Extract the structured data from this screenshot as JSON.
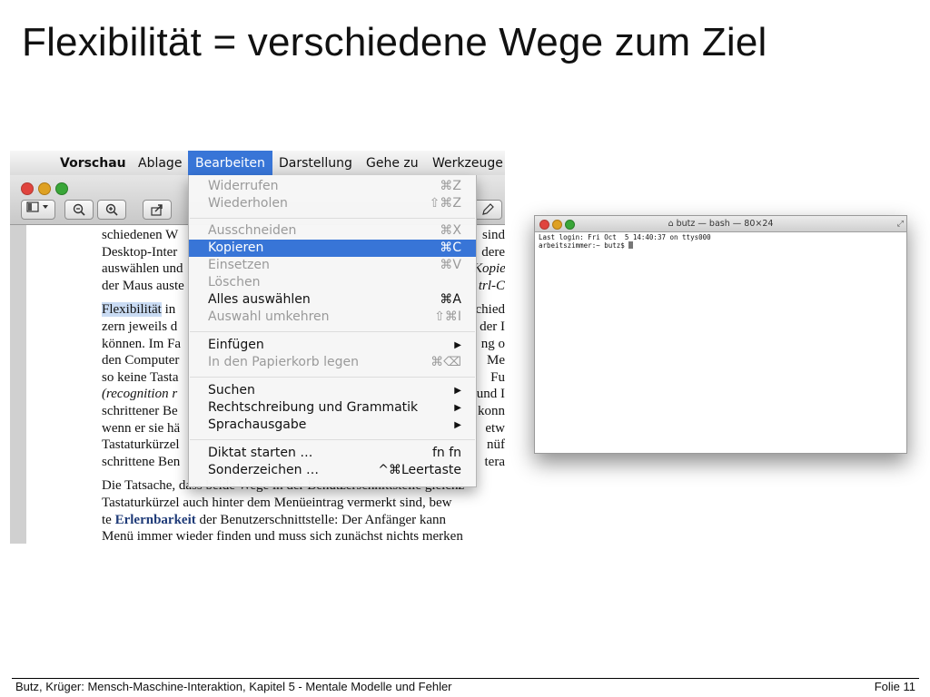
{
  "slide": {
    "title": "Flexibilität = verschiedene Wege zum Ziel",
    "footer_left": "Butz, Krüger: Mensch-Maschine-Interaktion, Kapitel 5 - Mentale Modelle und Fehler",
    "footer_right": "Folie  11"
  },
  "preview": {
    "menubar": {
      "apple": "",
      "items": [
        "Vorschau",
        "Ablage",
        "Bearbeiten",
        "Darstellung",
        "Gehe zu",
        "Werkzeuge"
      ],
      "active_index": 2
    },
    "menu": {
      "items": [
        {
          "label": "Widerrufen",
          "shortcut": "⌘Z",
          "state": "disabled"
        },
        {
          "label": "Wiederholen",
          "shortcut": "⇧⌘Z",
          "state": "disabled"
        },
        {
          "label": "Ausschneiden",
          "shortcut": "⌘X",
          "state": "disabled"
        },
        {
          "label": "Kopieren",
          "shortcut": "⌘C",
          "state": "selected"
        },
        {
          "label": "Einsetzen",
          "shortcut": "⌘V",
          "state": "disabled"
        },
        {
          "label": "Löschen",
          "shortcut": "",
          "state": "disabled"
        },
        {
          "label": "Alles auswählen",
          "shortcut": "⌘A",
          "state": "enabled"
        },
        {
          "label": "Auswahl umkehren",
          "shortcut": "⇧⌘I",
          "state": "disabled"
        },
        {
          "label": "Einfügen",
          "shortcut": "▶",
          "state": "enabled"
        },
        {
          "label": "In den Papierkorb legen",
          "shortcut": "⌘⌫",
          "state": "disabled"
        },
        {
          "label": "Suchen",
          "shortcut": "▶",
          "state": "enabled"
        },
        {
          "label": "Rechtschreibung und Grammatik",
          "shortcut": "▶",
          "state": "enabled"
        },
        {
          "label": "Sprachausgabe",
          "shortcut": "▶",
          "state": "enabled"
        },
        {
          "label": "Diktat starten …",
          "shortcut": "fn fn",
          "state": "enabled"
        },
        {
          "label": "Sonderzeichen …",
          "shortcut": "^⌘Leertaste",
          "state": "enabled"
        }
      ]
    },
    "doc_lines": [
      "schiedenen W",
      "Desktop-Inter",
      "auswählen und",
      "der Maus auste",
      "",
      "Flexibilität in",
      "zern jeweils d",
      "können. Im Fa",
      "den Computer",
      "so keine Tasta",
      "(recognition r",
      "schrittener Be",
      "wenn er sie hä",
      "Tastaturkürzel",
      "schrittene Ben",
      "",
      "Die Tatsache, dass beide Wege in der Benutzerschnittstelle gleichz",
      "Tastaturkürzel auch hinter dem Menüeintrag vermerkt sind, bew",
      "te Erlernbarkeit der Benutzerschnittstelle: Der Anfänger kann",
      "Menü immer wieder finden und muss sich zunächst nichts merken"
    ],
    "doc_right_fragments": [
      "sind",
      "dere",
      "Kopie",
      "trl-C",
      "",
      "chied",
      "der I",
      "ng o",
      "Me",
      "Fu",
      "und I",
      "konn",
      "etw",
      "nüf",
      "tera"
    ]
  },
  "terminal": {
    "title": "butz — bash — 80×24",
    "lines": [
      "Last login: Fri Oct  5 14:40:37 on ttys000",
      "arbeitszimmer:~ butz$ "
    ]
  }
}
